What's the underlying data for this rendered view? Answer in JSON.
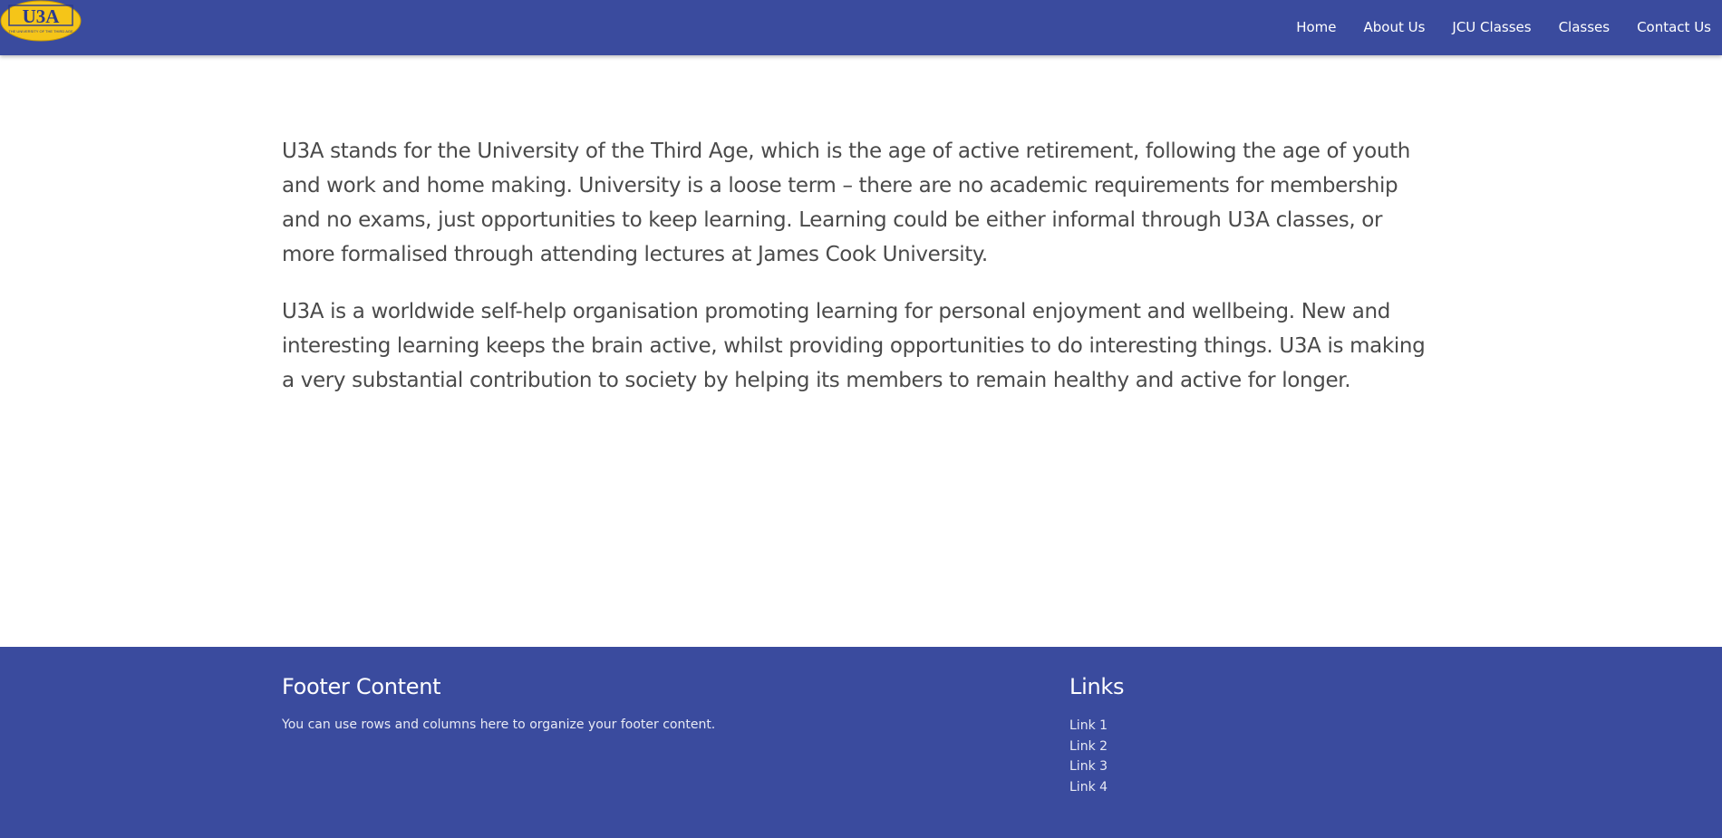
{
  "header": {
    "logo": {
      "text": "U3A",
      "subtitle": "THE UNIVERSITY OF THE THIRD AGE",
      "colors": {
        "oval": "#f5c518",
        "text": "#2b3a8f"
      }
    },
    "nav": [
      {
        "label": "Home"
      },
      {
        "label": "About Us"
      },
      {
        "label": "JCU Classes"
      },
      {
        "label": "Classes"
      },
      {
        "label": "Contact Us"
      }
    ]
  },
  "main": {
    "paragraphs": [
      "U3A stands for the University of the Third Age, which is the age of active retirement, following the age of youth and work and home making. University is a loose term – there are no academic requirements for membership and no exams, just opportunities to keep learning. Learning could be either informal through U3A classes, or more formalised through attending lectures at James Cook University.",
      "U3A is a worldwide self-help organisation promoting learning for personal enjoyment and wellbeing. New and interesting learning keeps the brain active, whilst providing opportunities to do interesting things. U3A is making a very substantial contribution to society by helping its members to remain healthy and active for longer."
    ]
  },
  "footer": {
    "content_title": "Footer Content",
    "content_text": "You can use rows and columns here to organize your footer content.",
    "links_title": "Links",
    "links": [
      {
        "label": "Link 1"
      },
      {
        "label": "Link 2"
      },
      {
        "label": "Link 3"
      },
      {
        "label": "Link 4"
      }
    ]
  },
  "colors": {
    "brand_blue": "#3a4b9e",
    "body_text": "#4a4a4a",
    "background": "#ffffff"
  }
}
